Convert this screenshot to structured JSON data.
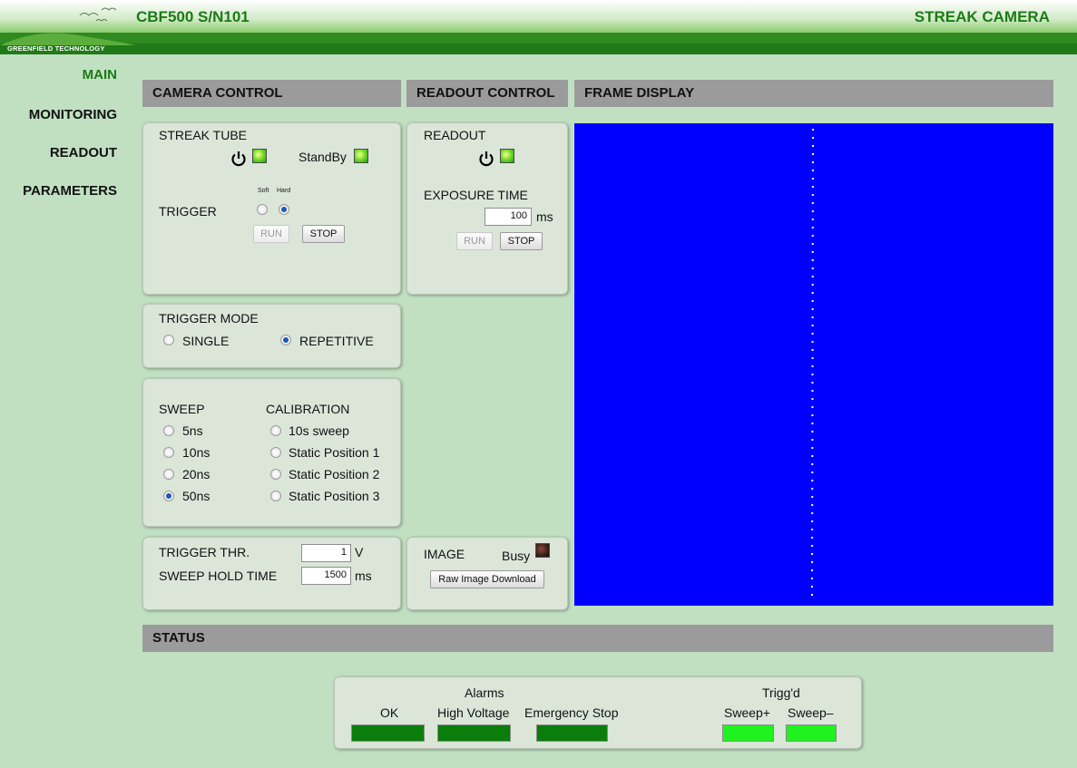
{
  "header": {
    "logo_text": "GREENFIELD TECHNOLOGY",
    "title": "CBF500 S/N101",
    "right_title": "STREAK CAMERA"
  },
  "nav": {
    "items": [
      {
        "label": "MAIN",
        "active": true
      },
      {
        "label": "MONITORING",
        "active": false
      },
      {
        "label": "READOUT",
        "active": false
      },
      {
        "label": "PARAMETERS",
        "active": false
      }
    ]
  },
  "sections": {
    "camera_control": "CAMERA CONTROL",
    "readout_control": "READOUT CONTROL",
    "frame_display": "FRAME DISPLAY",
    "status": "STATUS"
  },
  "streak_tube": {
    "title": "STREAK TUBE",
    "standby_label": "StandBy",
    "trigger_label": "TRIGGER",
    "soft_label": "Soft",
    "hard_label": "Hard",
    "selected": "Hard",
    "run_label": "RUN",
    "stop_label": "STOP"
  },
  "readout": {
    "title": "READOUT",
    "exposure_label": "EXPOSURE TIME",
    "exposure_value": "100",
    "exposure_unit": "ms",
    "run_label": "RUN",
    "stop_label": "STOP"
  },
  "trigger_mode": {
    "title": "TRIGGER MODE",
    "options": [
      "SINGLE",
      "REPETITIVE"
    ],
    "selected": "REPETITIVE"
  },
  "sweep": {
    "title": "SWEEP",
    "options": [
      "5ns",
      "10ns",
      "20ns",
      "50ns"
    ],
    "selected": "50ns"
  },
  "calibration": {
    "title": "CALIBRATION",
    "options": [
      "10s sweep",
      "Static Position 1",
      "Static Position 2",
      "Static Position 3"
    ]
  },
  "thresholds": {
    "trigger_thr_label": "TRIGGER THR.",
    "trigger_thr_value": "1",
    "trigger_thr_unit": "V",
    "sweep_hold_label": "SWEEP HOLD TIME",
    "sweep_hold_value": "1500",
    "sweep_hold_unit": "ms"
  },
  "image": {
    "title": "IMAGE",
    "busy_label": "Busy",
    "download_label": "Raw Image Download"
  },
  "frame": {
    "background": "#0000ff",
    "line_color": "#ffffff"
  },
  "status": {
    "alarms_title": "Alarms",
    "alarms": [
      {
        "label": "OK",
        "color": "#0a7d0a"
      },
      {
        "label": "High Voltage",
        "color": "#0a7d0a"
      },
      {
        "label": "Emergency Stop",
        "color": "#0a7d0a"
      }
    ],
    "trigg_title": "Trigg'd",
    "trigg": [
      {
        "label": "Sweep+",
        "color": "#1ff21f"
      },
      {
        "label": "Sweep–",
        "color": "#1ff21f"
      }
    ]
  }
}
